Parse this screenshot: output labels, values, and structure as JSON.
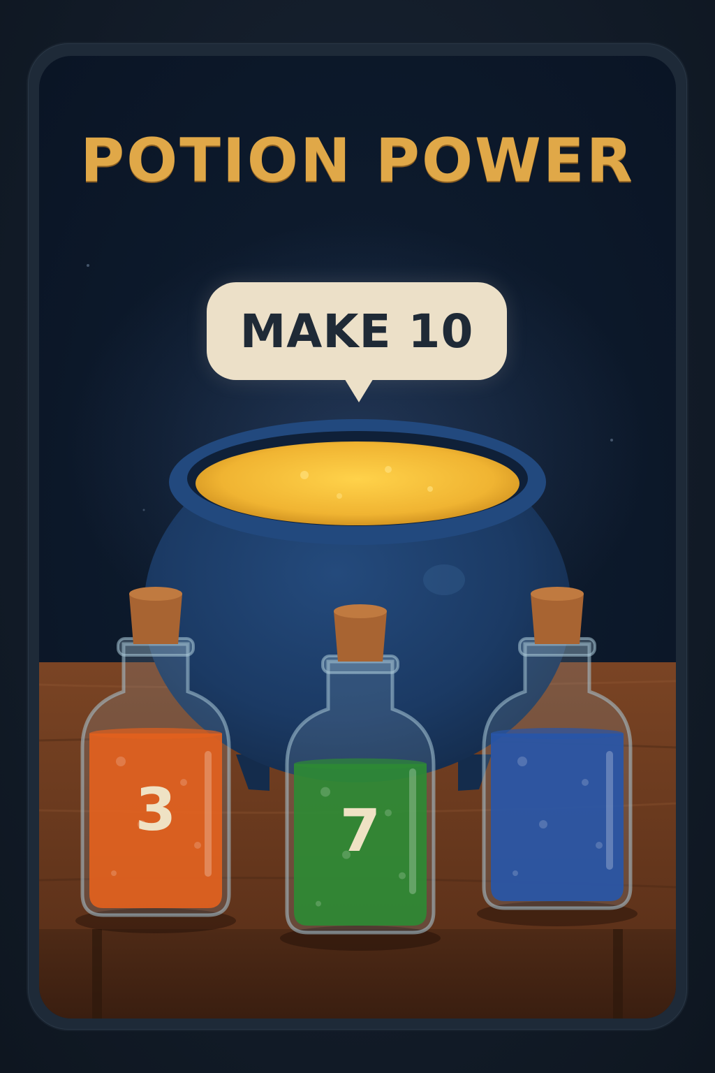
{
  "title": "POTION POWER",
  "prompt": "MAKE 10",
  "vials": [
    {
      "number": "3",
      "liquid_color": "#e2611e",
      "fill_level": 0.7
    },
    {
      "number": "7",
      "liquid_color": "#2e8a34",
      "fill_level": 0.65
    },
    {
      "number": "",
      "liquid_color": "#2856a8",
      "fill_level": 0.7
    }
  ],
  "cauldron_liquid_color": "#f0b432",
  "colors": {
    "title": "#e0a848",
    "bubble": "#ece0c8",
    "bubble_text": "#1f2a36",
    "cauldron": "#1c3a66",
    "table": "#6a3a1c",
    "cork": "#a86432"
  }
}
